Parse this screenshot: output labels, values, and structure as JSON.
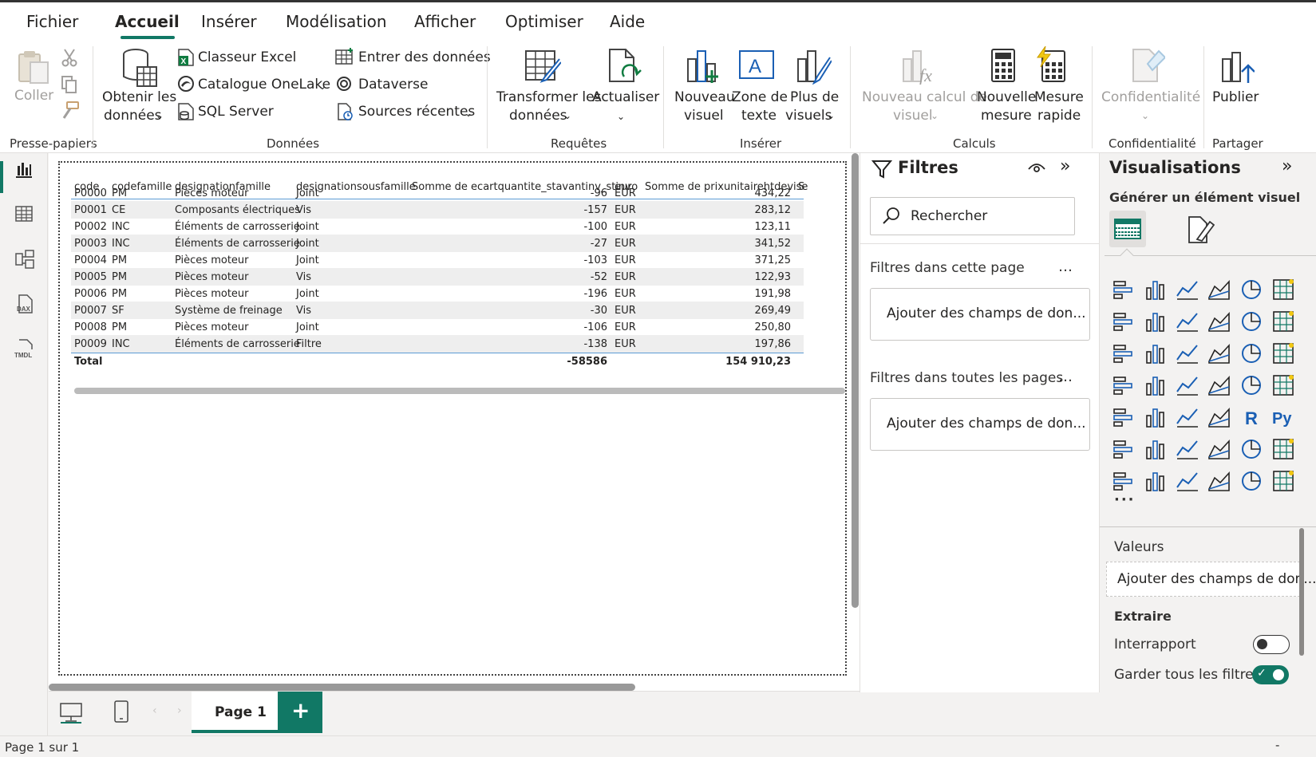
{
  "menu": {
    "tabs": [
      "Fichier",
      "Accueil",
      "Insérer",
      "Modélisation",
      "Afficher",
      "Optimiser",
      "Aide"
    ],
    "active": "Accueil"
  },
  "ribbon": {
    "clipboard": {
      "paste": "Coller",
      "group": "Presse-papiers"
    },
    "data": {
      "get_data_1": "Obtenir les",
      "get_data_2": "données",
      "excel": "Classeur Excel",
      "onelake": "Catalogue OneLake",
      "sql": "SQL Server",
      "enter": "Entrer des données",
      "dataverse": "Dataverse",
      "recent": "Sources récentes",
      "group": "Données"
    },
    "queries": {
      "transform_1": "Transformer les",
      "transform_2": "données",
      "refresh": "Actualiser",
      "group": "Requêtes"
    },
    "insert": {
      "new_visual_1": "Nouveau",
      "new_visual_2": "visuel",
      "textbox_1": "Zone de",
      "textbox_2": "texte",
      "more_1": "Plus de",
      "more_2": "visuels",
      "group": "Insérer"
    },
    "calcs": {
      "new_calc_1": "Nouveau calcul de",
      "new_calc_2": "visuel",
      "new_measure_1": "Nouvelle",
      "new_measure_2": "mesure",
      "quick_1": "Mesure",
      "quick_2": "rapide",
      "group": "Calculs"
    },
    "sensitivity": {
      "label": "Confidentialité",
      "group": "Confidentialité"
    },
    "share": {
      "publish": "Publier",
      "group": "Partager"
    }
  },
  "table": {
    "headers": [
      "code",
      "codefamille",
      "designationfamille",
      "designationsousfamille",
      "Somme de ecartquantite_stavantinv_stinv",
      "euro",
      "Somme de prixunitairehtdevise",
      "S"
    ],
    "rows": [
      [
        "P0000",
        "PM",
        "Pièces moteur",
        "Joint",
        "-96",
        "EUR",
        "434,22"
      ],
      [
        "P0001",
        "CE",
        "Composants électriques",
        "Vis",
        "-157",
        "EUR",
        "283,12"
      ],
      [
        "P0002",
        "INC",
        "Éléments de carrosserie",
        "Joint",
        "-100",
        "EUR",
        "123,11"
      ],
      [
        "P0003",
        "INC",
        "Éléments de carrosserie",
        "Joint",
        "-27",
        "EUR",
        "341,52"
      ],
      [
        "P0004",
        "PM",
        "Pièces moteur",
        "Joint",
        "-103",
        "EUR",
        "371,25"
      ],
      [
        "P0005",
        "PM",
        "Pièces moteur",
        "Vis",
        "-52",
        "EUR",
        "122,93"
      ],
      [
        "P0006",
        "PM",
        "Pièces moteur",
        "Joint",
        "-196",
        "EUR",
        "191,98"
      ],
      [
        "P0007",
        "SF",
        "Système de freinage",
        "Vis",
        "-30",
        "EUR",
        "269,49"
      ],
      [
        "P0008",
        "PM",
        "Pièces moteur",
        "Joint",
        "-106",
        "EUR",
        "250,80"
      ],
      [
        "P0009",
        "INC",
        "Éléments de carrosserie",
        "Filtre",
        "-138",
        "EUR",
        "197,86"
      ]
    ],
    "total": {
      "label": "Total",
      "qty": "-58586",
      "price": "154 910,23"
    }
  },
  "pages": {
    "current": "Page 1",
    "add": "+"
  },
  "filters": {
    "title": "Filtres",
    "search_placeholder": "Rechercher",
    "this_page": "Filtres dans cette page",
    "all_pages": "Filtres dans toutes les pages",
    "add_fields": "Ajouter des champs de don...",
    "more": "…"
  },
  "viz": {
    "title": "Visualisations",
    "build": "Générer un élément visuel",
    "more": "···",
    "values": "Valeurs",
    "add_fields": "Ajouter des champs de don...",
    "drillthrough": "Extraire",
    "cross_report": "Interrapport",
    "keep_filters": "Garder tous les filtres",
    "cross_report_on": false,
    "keep_filters_on": true
  },
  "status": {
    "page": "Page 1 sur 1"
  },
  "colors": {
    "accent": "#117865",
    "excel": "#107c41",
    "icon_blue": "#1a5fb4",
    "yellow": "#f2c811"
  }
}
